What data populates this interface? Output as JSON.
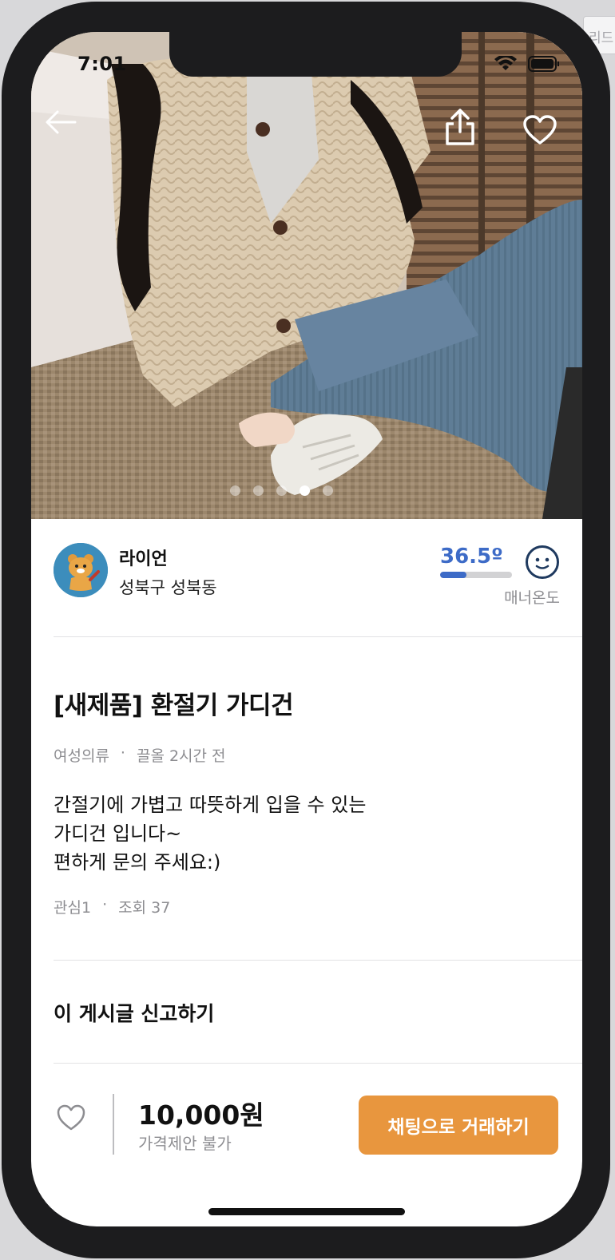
{
  "status_bar": {
    "time": "7:01"
  },
  "background_tab": {
    "label": "리드"
  },
  "product_photo": {
    "image_count": 5,
    "active_index": 3
  },
  "seller": {
    "name": "라이언",
    "location": "성북구 성북동",
    "manner_temperature": "36.5º",
    "manner_temperature_fill_percent": 36.5,
    "manner_label": "매너온도"
  },
  "post": {
    "title": "[새제품] 환절기 가디건",
    "category": "여성의류",
    "bumped_time": "끌올 2시간 전",
    "description": "간절기에 가볍고 따뜻하게 입을 수 있는\n가디건 입니다~\n편하게 문의 주세요:)",
    "interest": "관심1",
    "views": "조회 37",
    "separator": "·"
  },
  "report_label": "이 게시글 신고하기",
  "bottom_bar": {
    "price": "10,000원",
    "price_note": "가격제안 불가",
    "chat_button_label": "채팅으로 거래하기"
  },
  "colors": {
    "accent_orange": "#e8963e",
    "temperature_blue": "#3d6bc7",
    "avatar_bg": "#3c8dbc"
  },
  "icons": [
    "back-arrow-icon",
    "share-icon",
    "heart-outline-icon",
    "smile-face-icon",
    "wifi-icon",
    "battery-icon",
    "ryan-avatar-icon"
  ]
}
